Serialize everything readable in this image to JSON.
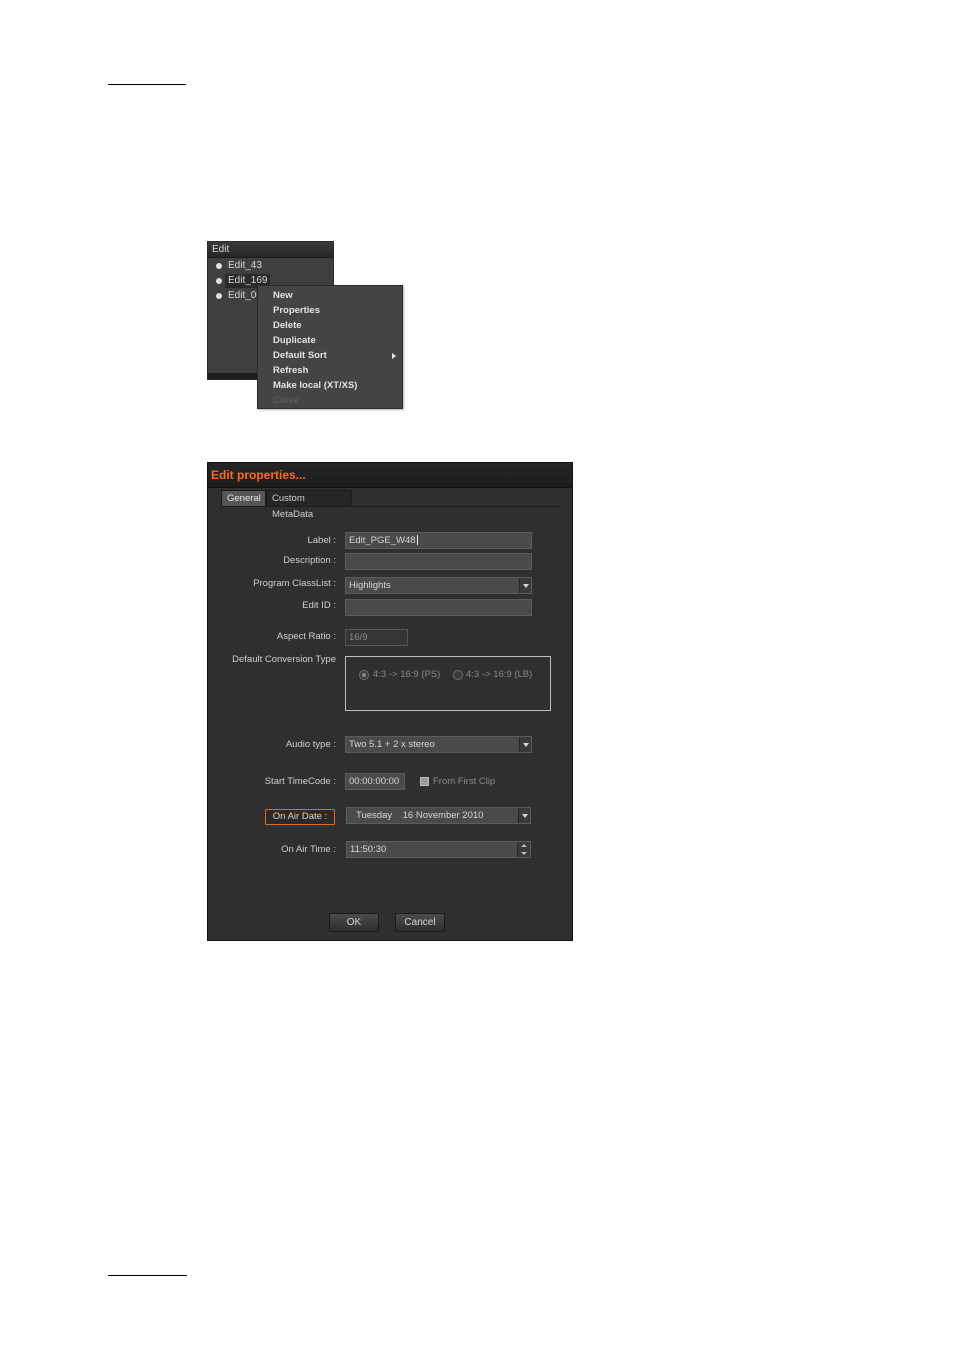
{
  "edit_panel": {
    "header": "Edit",
    "items": [
      {
        "label": "Edit_43"
      },
      {
        "label": "Edit_169"
      },
      {
        "label": "Edit_00"
      }
    ]
  },
  "context_menu": {
    "items": [
      {
        "label": "New"
      },
      {
        "label": "Properties"
      },
      {
        "label": "Delete"
      },
      {
        "label": "Duplicate"
      },
      {
        "label": "Default Sort"
      },
      {
        "label": "Refresh"
      },
      {
        "label": "Make local (XT/XS)"
      },
      {
        "label": "Close"
      }
    ]
  },
  "dialog": {
    "title": "Edit properties...",
    "tabs": [
      {
        "label": "General",
        "active": true
      },
      {
        "label": "Custom MetaData",
        "active": false
      }
    ],
    "label_field": {
      "label": "Label :",
      "value": "Edit_PGE_W48"
    },
    "description_field": {
      "label": "Description :",
      "value": ""
    },
    "program_classlist": {
      "label": "Program ClassList :",
      "value": "Highlights"
    },
    "edit_id": {
      "label": "Edit ID :",
      "value": ""
    },
    "aspect_ratio": {
      "label": "Aspect Ratio :",
      "value": "16/9"
    },
    "default_conversion": {
      "label": "Default Conversion Type",
      "options": [
        {
          "label": "4:3 -> 16:9 (PS)",
          "checked": true
        },
        {
          "label": "4:3 -> 16:9 (LB)",
          "checked": false
        }
      ]
    },
    "audio_type": {
      "label": "Audio type :",
      "value": "Two 5.1 + 2 x stereo"
    },
    "start_timecode": {
      "label": "Start TimeCode :",
      "value": "00:00:00:00"
    },
    "from_first_clip": {
      "label": "From First Clip",
      "checked": true
    },
    "on_air_date": {
      "button_label": "On Air Date :",
      "value": "Tuesday    16 November 2010"
    },
    "on_air_time": {
      "label": "On Air Time :",
      "value": "11:50:30"
    },
    "ok_label": "OK",
    "cancel_label": "Cancel"
  },
  "colors": {
    "accent": "#ff6a1a",
    "dialog_bg": "#2f2f2f",
    "menu_bg": "#444444"
  }
}
